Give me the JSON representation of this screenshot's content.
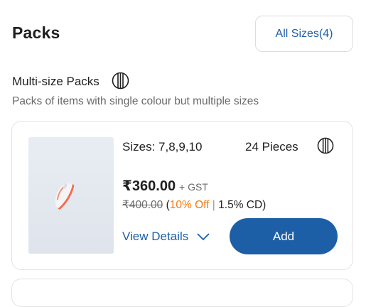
{
  "header": {
    "title": "Packs",
    "sizes_filter_label": "All Sizes(4)"
  },
  "section": {
    "title": "Multi-size Packs",
    "subtitle": "Packs of items with single colour but multiple sizes",
    "icon": "striped-circle-icon"
  },
  "pack_card": {
    "image": "sneaker-product-image",
    "sizes": "Sizes: 7,8,9,10",
    "pieces": "24 Pieces",
    "price": "₹360.00",
    "gst": "+ GST",
    "mrp": "₹400.00",
    "discount": "10% Off",
    "cd": "1.5% CD)",
    "paren_open": "(",
    "separator": "|",
    "view_details": "View Details",
    "add_label": "Add"
  },
  "colors": {
    "accent": "#1d5fa6",
    "discount": "#f07a12",
    "muted": "#6a6a6a"
  }
}
